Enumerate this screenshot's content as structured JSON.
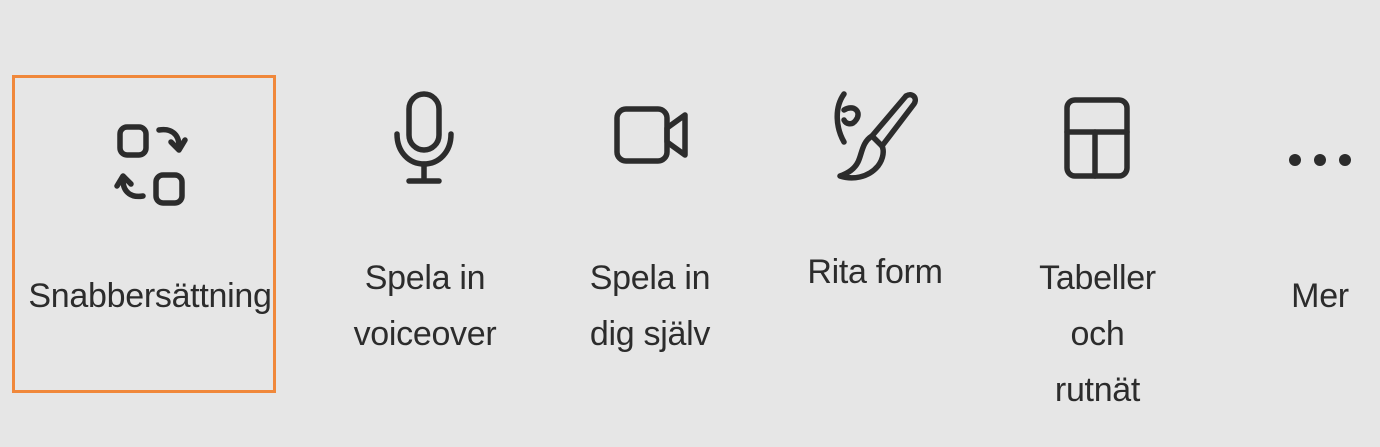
{
  "toolbar": {
    "items": [
      {
        "label": "Snabbersättning",
        "icon": "swap-arrows-icon",
        "selected": true
      },
      {
        "label": "Spela in\nvoiceover",
        "icon": "microphone-icon",
        "selected": false
      },
      {
        "label": "Spela in\ndig själv",
        "icon": "video-camera-icon",
        "selected": false
      },
      {
        "label": "Rita form",
        "icon": "paintbrush-icon",
        "selected": false
      },
      {
        "label": "Tabeller\noch\nrutnät",
        "icon": "table-grid-icon",
        "selected": false
      },
      {
        "label": "Mer",
        "icon": "more-dots-icon",
        "selected": false
      }
    ]
  },
  "colors": {
    "background": "#e6e6e6",
    "icon": "#2c2c2c",
    "selection_border": "#f0883b"
  }
}
